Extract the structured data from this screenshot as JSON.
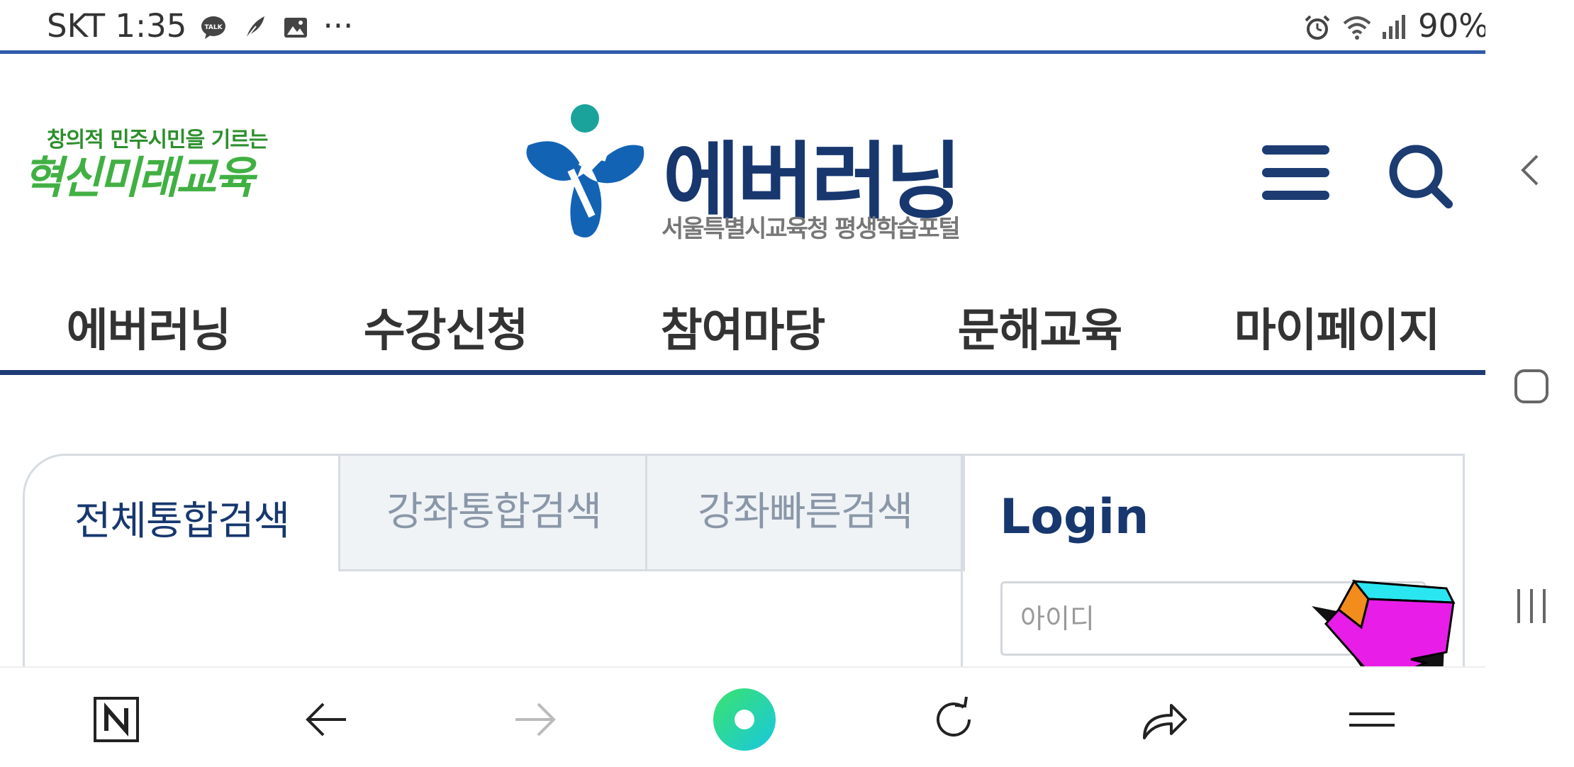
{
  "status_bar": {
    "carrier_time": "SKT 1:35",
    "overflow": "···",
    "battery": "90%",
    "icons": [
      "talk-icon",
      "feather-icon",
      "image-icon",
      "alarm-icon",
      "wifi-icon",
      "signal-icon",
      "battery-icon"
    ]
  },
  "header": {
    "slogan_top": "창의적 민주시민을 기르는",
    "slogan_main": "혁신미래교육",
    "logo_title": "에버러닝",
    "logo_subtitle": "서울특별시교육청 평생학습포털"
  },
  "nav": {
    "items": [
      {
        "label": "에버러닝"
      },
      {
        "label": "수강신청"
      },
      {
        "label": "참여마당"
      },
      {
        "label": "문해교육"
      },
      {
        "label": "마이페이지"
      }
    ]
  },
  "search_tabs": {
    "all": "전체통합검색",
    "course": "강좌통합검색",
    "quick": "강좌빠른검색"
  },
  "login": {
    "title": "Login",
    "id_placeholder": "아이디"
  },
  "colors": {
    "brand_navy": "#17376e",
    "status_line": "#2e5aa9",
    "green": "#41b043",
    "tab_inactive_bg": "#eff3f6"
  }
}
